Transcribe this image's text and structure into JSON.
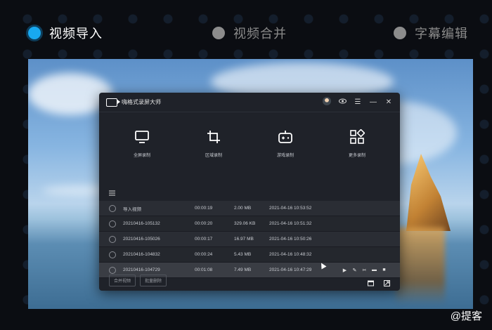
{
  "steps": [
    {
      "label": "视频导入",
      "active": true
    },
    {
      "label": "视频合并",
      "active": false
    },
    {
      "label": "字幕编辑",
      "active": false
    }
  ],
  "app": {
    "title": "嗨格式录屏大师",
    "tools": [
      {
        "label": "全屏录制",
        "icon": "monitor-icon"
      },
      {
        "label": "区域录制",
        "icon": "crop-icon"
      },
      {
        "label": "游戏录制",
        "icon": "gamepad-icon"
      },
      {
        "label": "更多录制",
        "icon": "grid-icon"
      }
    ],
    "files": [
      {
        "name": "导入视频",
        "duration": "00:00:19",
        "size": "2.00 MB",
        "time": "2021-04-16 10:53:52"
      },
      {
        "name": "20210416-105132",
        "duration": "00:00:20",
        "size": "329.06 KB",
        "time": "2021-04-16 10:51:32"
      },
      {
        "name": "20210416-105026",
        "duration": "00:00:17",
        "size": "16.97 MB",
        "time": "2021-04-16 10:50:26"
      },
      {
        "name": "20210416-104832",
        "duration": "00:00:24",
        "size": "5.43 MB",
        "time": "2021-04-16 10:48:32"
      },
      {
        "name": "20210416-104729",
        "duration": "00:01:08",
        "size": "7.49 MB",
        "time": "2021-04-16 10:47:29"
      }
    ],
    "footer": {
      "merge_label": "合并视频",
      "batch_delete_label": "批量删除"
    }
  },
  "watermark": "@提客"
}
